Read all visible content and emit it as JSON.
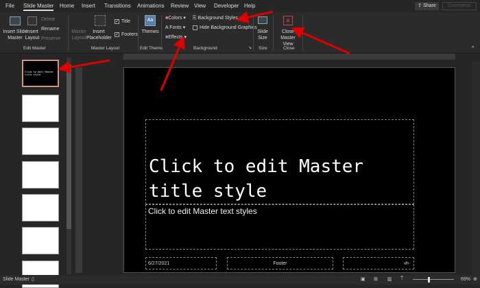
{
  "tabs": [
    "File",
    "Slide Master",
    "Home",
    "Insert",
    "Transitions",
    "Animations",
    "Review",
    "View",
    "Developer",
    "Help"
  ],
  "share_label": "Share",
  "comments_label": "Comments",
  "ribbon": {
    "insert_slide_master": "Insert Slide Master",
    "insert_layout": "Insert Layout",
    "delete": "Delete",
    "rename": "Rename",
    "preserve": "Preserve",
    "edit_master": "Edit Master",
    "master_layout_btn": "Master Layout",
    "insert_placeholder": "Insert Placeholder",
    "title_chk": "Title",
    "footers_chk": "Footers",
    "master_layout": "Master Layout",
    "themes": "Themes",
    "edit_theme": "Edit Theme",
    "colors": "Colors",
    "fonts": "Fonts",
    "effects": "Effects",
    "background_styles": "Background Styles",
    "hide_bg": "Hide Background Graphics",
    "background": "Background",
    "slide_size": "Slide Size",
    "size": "Size",
    "close_master": "Close Master View",
    "close": "Close",
    "title_checked": true,
    "footers_checked": true
  },
  "thumb_text": "Click to edit Master title style",
  "slide": {
    "title": "Click to edit Master title style",
    "body": "Click to edit Master text styles",
    "date": "6/27/2021",
    "footer": "Footer",
    "number": "‹#›"
  },
  "status": {
    "view": "Slide Master",
    "zoom": "69%"
  },
  "accent": "#e00000"
}
